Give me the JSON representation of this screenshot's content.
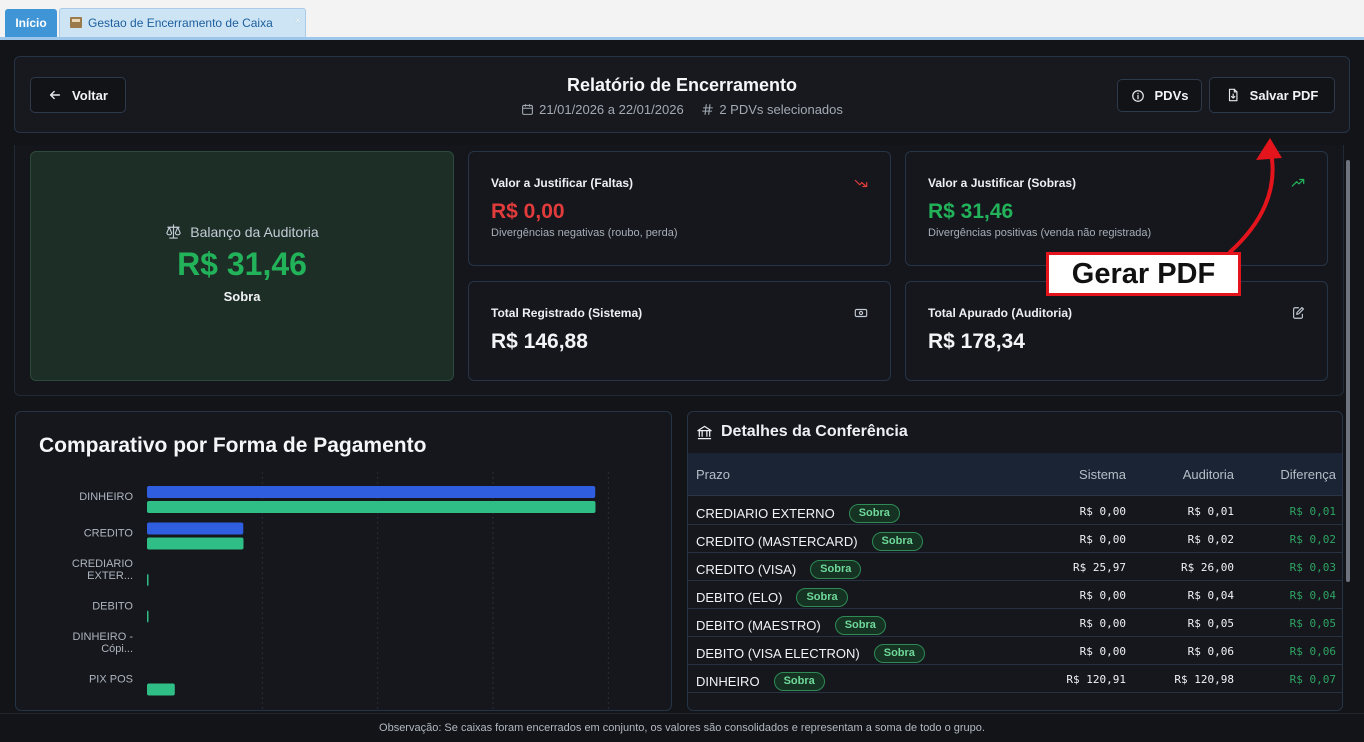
{
  "tabs": {
    "home": "Início",
    "active": "Gestao de Encerramento de Caixa",
    "close": "×"
  },
  "header": {
    "back": "Voltar",
    "title": "Relatório de Encerramento",
    "date_range": "21/01/2026 a 22/01/2026",
    "pdvs_selected": "2 PDVs selecionados",
    "pdvs_button": "PDVs",
    "save_pdf": "Salvar PDF"
  },
  "balance": {
    "label": "Balanço da Auditoria",
    "value": "R$ 31,46",
    "status": "Sobra"
  },
  "stats": {
    "faltas": {
      "title": "Valor a Justificar (Faltas)",
      "value": "R$ 0,00",
      "desc": "Divergências negativas (roubo, perda)",
      "icon": "trending-down-icon",
      "color": "#e23b3b"
    },
    "sobras": {
      "title": "Valor a Justificar (Sobras)",
      "value": "R$ 31,46",
      "desc": "Divergências positivas (venda não registrada)",
      "icon": "trending-up-icon",
      "color": "#22b35a"
    },
    "registrado": {
      "title": "Total Registrado (Sistema)",
      "value": "R$ 146,88",
      "icon": "banknote-icon"
    },
    "apurado": {
      "title": "Total Apurado (Auditoria)",
      "value": "R$ 178,34",
      "icon": "edit-icon"
    }
  },
  "annotation": {
    "text": "Gerar PDF",
    "color": "#e3141b"
  },
  "chart": {
    "title": "Comparativo por Forma de Pagamento"
  },
  "chart_data": {
    "type": "bar",
    "orientation": "horizontal",
    "categories": [
      "DINHEIRO",
      "CREDITO",
      "CREDIARIO EXTER...",
      "DEBITO",
      "DINHEIRO - Cópi...",
      "PIX POS"
    ],
    "series": [
      {
        "name": "",
        "color": "#2f5fe0",
        "values": [
          120.91,
          25.97,
          0.0,
          0.0,
          0.0,
          0.0
        ]
      },
      {
        "name": "",
        "color": "#2fbf86",
        "values": [
          120.98,
          26.03,
          0.01,
          0.15,
          0.0,
          7.5
        ]
      }
    ],
    "xlim": [
      0,
      140
    ],
    "grid": true
  },
  "table": {
    "title": "Detalhes da Conferência",
    "columns": [
      "Prazo",
      "Sistema",
      "Auditoria",
      "Diferença"
    ],
    "rows": [
      {
        "name": "CREDIARIO EXTERNO",
        "badge": "Sobra",
        "sistema": "R$ 0,00",
        "auditoria": "R$ 0,01",
        "diferenca": "R$ 0,01"
      },
      {
        "name": "CREDITO (MASTERCARD)",
        "badge": "Sobra",
        "sistema": "R$ 0,00",
        "auditoria": "R$ 0,02",
        "diferenca": "R$ 0,02"
      },
      {
        "name": "CREDITO (VISA)",
        "badge": "Sobra",
        "sistema": "R$ 25,97",
        "auditoria": "R$ 26,00",
        "diferenca": "R$ 0,03"
      },
      {
        "name": "DEBITO (ELO)",
        "badge": "Sobra",
        "sistema": "R$ 0,00",
        "auditoria": "R$ 0,04",
        "diferenca": "R$ 0,04"
      },
      {
        "name": "DEBITO (MAESTRO)",
        "badge": "Sobra",
        "sistema": "R$ 0,00",
        "auditoria": "R$ 0,05",
        "diferenca": "R$ 0,05"
      },
      {
        "name": "DEBITO (VISA ELECTRON)",
        "badge": "Sobra",
        "sistema": "R$ 0,00",
        "auditoria": "R$ 0,06",
        "diferenca": "R$ 0,06"
      },
      {
        "name": "DINHEIRO",
        "badge": "Sobra",
        "sistema": "R$ 120,91",
        "auditoria": "R$ 120,98",
        "diferenca": "R$ 0,07"
      }
    ]
  },
  "footer": "Observação: Se caixas foram encerrados em conjunto, os valores são consolidados e representam a soma de todo o grupo."
}
